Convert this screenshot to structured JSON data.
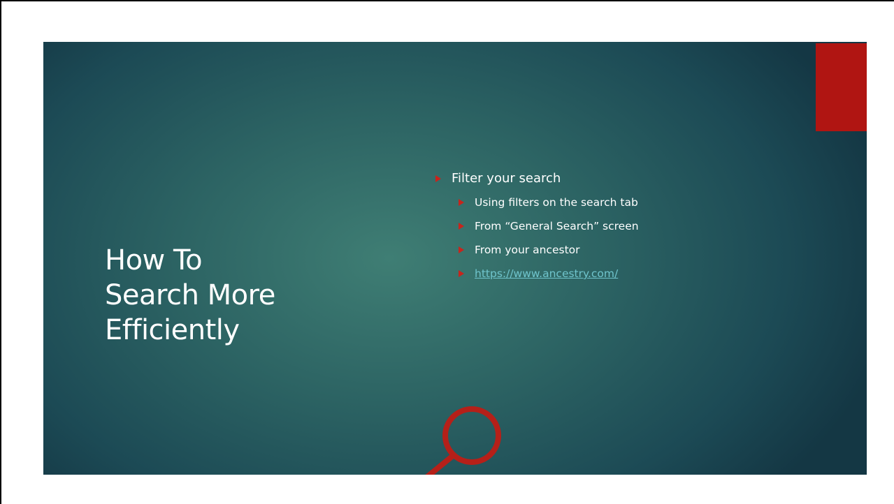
{
  "slide": {
    "title_lines": [
      "How To",
      "Search More",
      "Efficiently"
    ],
    "bullets": {
      "main": "Filter your search",
      "sub": [
        "Using filters on the search tab",
        "From “General Search” screen",
        "From your ancestor"
      ],
      "link": "https://www.ancestry.com/"
    },
    "icons": {
      "bullet": "arrow-bullet-icon",
      "graphic": "magnifying-glass-icon"
    },
    "colors": {
      "background_center": "#3f7e74",
      "background_edge": "#143744",
      "accent": "#b01512",
      "bullet": "#c8241c",
      "link": "#6fc4cc",
      "text": "#ffffff"
    }
  }
}
